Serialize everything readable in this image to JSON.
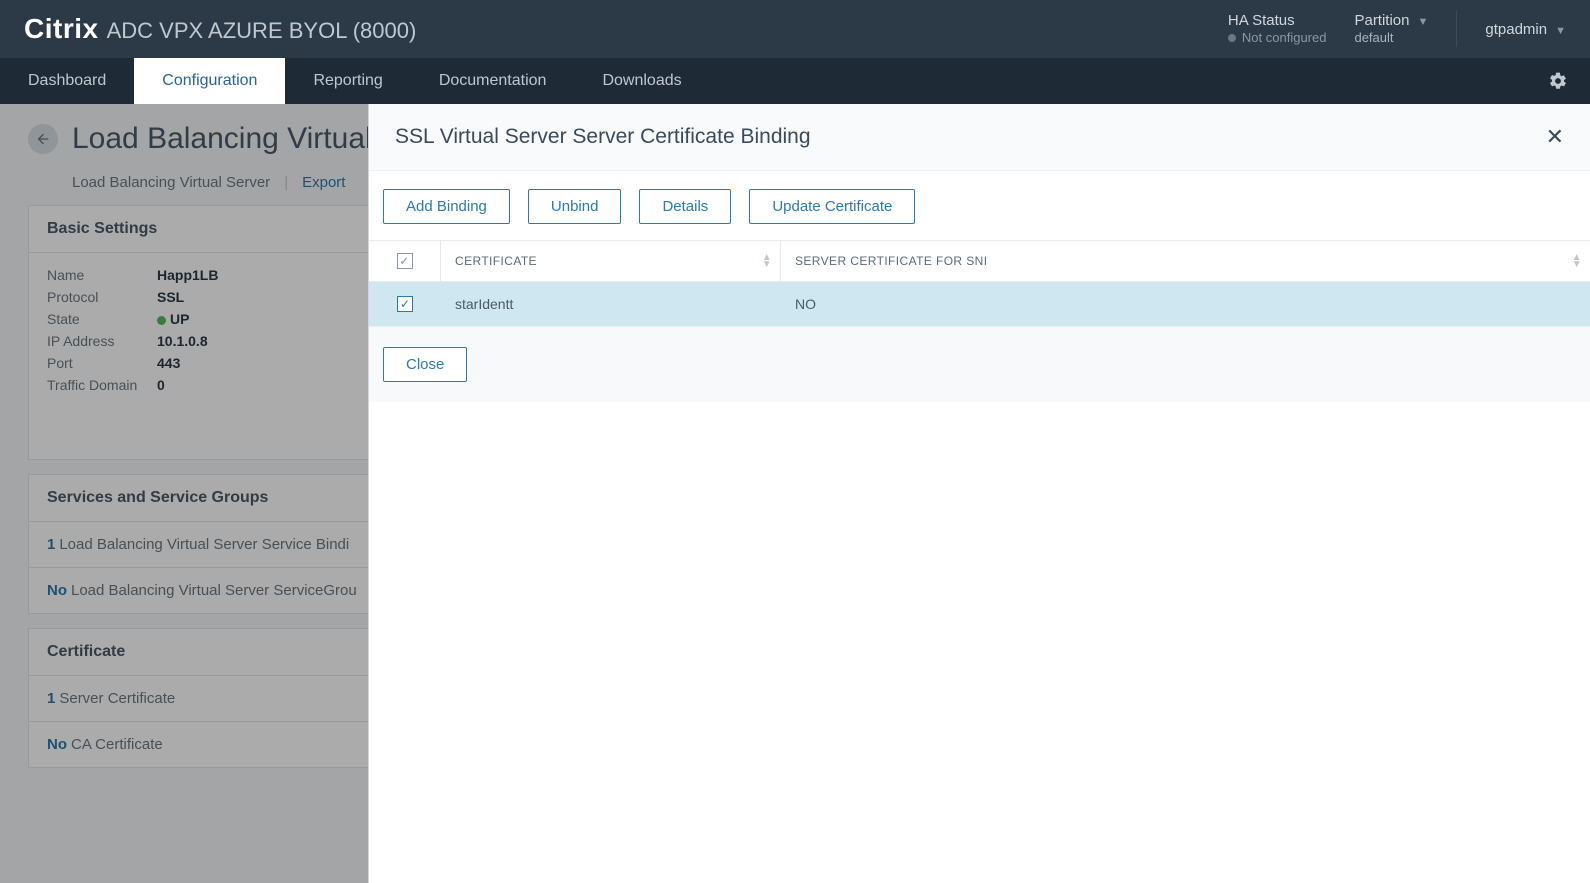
{
  "brand": {
    "name": "Citrix",
    "suffix": "ADC VPX AZURE BYOL (8000)"
  },
  "header": {
    "ha_label": "HA Status",
    "ha_value": "Not configured",
    "partition_label": "Partition",
    "partition_value": "default",
    "user": "gtpadmin"
  },
  "nav": {
    "dashboard": "Dashboard",
    "configuration": "Configuration",
    "reporting": "Reporting",
    "documentation": "Documentation",
    "downloads": "Downloads"
  },
  "page": {
    "title": "Load Balancing Virtual",
    "breadcrumb": "Load Balancing Virtual Server",
    "export": "Export"
  },
  "basic": {
    "panel_title": "Basic Settings",
    "name_label": "Name",
    "name_value": "Happ1LB",
    "protocol_label": "Protocol",
    "protocol_value": "SSL",
    "state_label": "State",
    "state_value": "UP",
    "ip_label": "IP Address",
    "ip_value": "10.1.0.8",
    "port_label": "Port",
    "port_value": "443",
    "td_label": "Traffic Domain",
    "td_value": "0"
  },
  "services": {
    "panel_title": "Services and Service Groups",
    "row1_count": "1",
    "row1_text": "Load Balancing Virtual Server Service Bindi",
    "row2_count": "No",
    "row2_text": "Load Balancing Virtual Server ServiceGrou"
  },
  "cert": {
    "panel_title": "Certificate",
    "row1_count": "1",
    "row1_text": "Server Certificate",
    "row2_count": "No",
    "row2_text": "CA Certificate"
  },
  "slideover": {
    "title": "SSL Virtual Server Server Certificate Binding",
    "add_binding": "Add Binding",
    "unbind": "Unbind",
    "details": "Details",
    "update_cert": "Update Certificate",
    "col_certificate": "CERTIFICATE",
    "col_sni": "SERVER CERTIFICATE FOR SNI",
    "rows": [
      {
        "certificate": "starIdentt",
        "sni": "NO"
      }
    ],
    "close": "Close"
  }
}
